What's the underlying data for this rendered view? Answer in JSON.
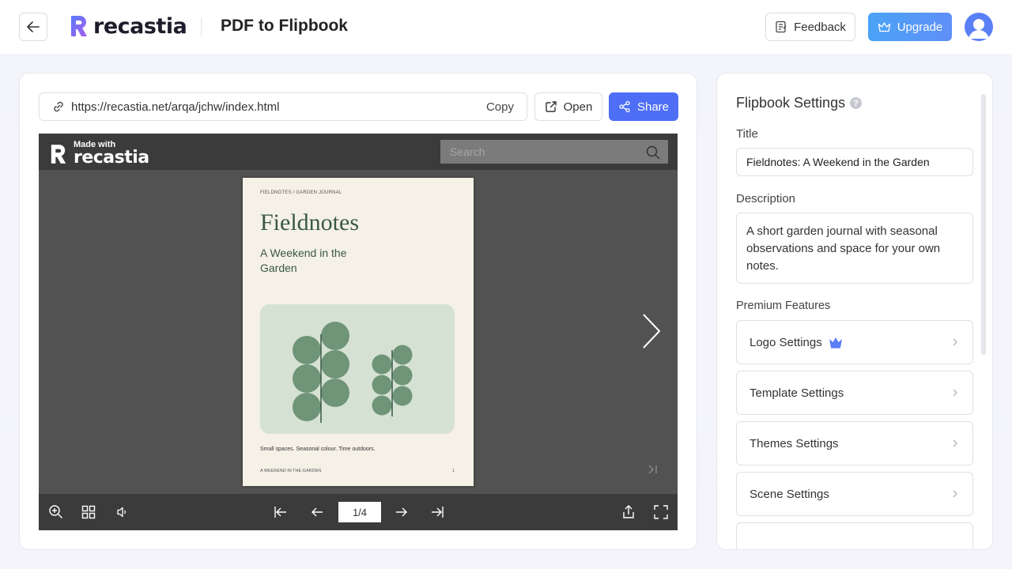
{
  "header": {
    "logo_text": "recastia",
    "page_title": "PDF to Flipbook",
    "feedback_label": "Feedback",
    "upgrade_label": "Upgrade"
  },
  "share_bar": {
    "url": "https://recastia.net/arqa/jchw/index.html",
    "copy_label": "Copy",
    "open_label": "Open",
    "share_label": "Share"
  },
  "viewer": {
    "made_with_small": "Made with",
    "made_with_big": "recastia",
    "search_placeholder": "Search",
    "page_indicator": "1/4",
    "page": {
      "header_text": "FIELDNOTES / GARDEN JOURNAL",
      "title": "Fieldnotes",
      "subtitle": "A Weekend in the Garden",
      "tagline": "Small spaces. Seasonal colour. Time outdoors.",
      "footer_left": "A WEEKEND IN THE GARDEN",
      "footer_right": "1"
    }
  },
  "settings": {
    "panel_title": "Flipbook Settings",
    "title_label": "Title",
    "title_value": "Fieldnotes: A Weekend in the Garden",
    "description_label": "Description",
    "description_value": "A short garden journal with seasonal observations and space for your own notes.",
    "premium_label": "Premium Features",
    "features": [
      {
        "label": "Logo Settings"
      },
      {
        "label": "Template Settings"
      },
      {
        "label": "Themes Settings"
      },
      {
        "label": "Scene Settings"
      }
    ]
  },
  "colors": {
    "accent": "#4d6ef5",
    "upgrade_gradient_start": "#4aa3f6",
    "viewer_bg": "#525252",
    "viewer_bar": "#3b3b3b",
    "page_green": "#3a5847",
    "art_bg": "#d5e1d3"
  },
  "icons": {
    "back": "arrow-left-icon",
    "feedback": "feedback-icon",
    "upgrade": "crown-icon",
    "link": "link-icon",
    "open": "external-link-icon",
    "share": "share-icon"
  }
}
